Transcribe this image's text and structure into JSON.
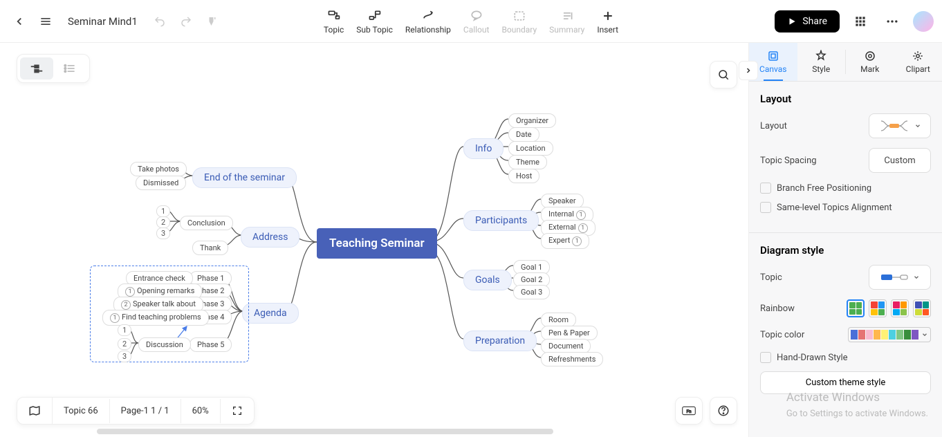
{
  "header": {
    "doc_title": "Seminar Mind1",
    "tb_items": [
      {
        "label": "Topic",
        "disabled": false
      },
      {
        "label": "Sub Topic",
        "disabled": false
      },
      {
        "label": "Relationship",
        "disabled": false
      },
      {
        "label": "Callout",
        "disabled": true
      },
      {
        "label": "Boundary",
        "disabled": true
      },
      {
        "label": "Summary",
        "disabled": true
      },
      {
        "label": "Insert",
        "disabled": false
      }
    ],
    "share": "Share"
  },
  "sidebar": {
    "tabs": [
      "Canvas",
      "Style",
      "Mark",
      "Clipart"
    ],
    "layout": {
      "title": "Layout",
      "layout_lbl": "Layout",
      "spacing_lbl": "Topic Spacing",
      "spacing_val": "Custom",
      "chk1": "Branch Free Positioning",
      "chk2": "Same-level Topics Alignment"
    },
    "diagram": {
      "title": "Diagram style",
      "topic_lbl": "Topic",
      "rainbow_lbl": "Rainbow",
      "color_lbl": "Topic color",
      "hand_lbl": "Hand-Drawn Style",
      "custom_btn": "Custom theme style"
    }
  },
  "bottom": {
    "topic": "Topic 66",
    "page": "Page-1  1 / 1",
    "zoom": "60%"
  },
  "watermark": {
    "l1": "Activate Windows",
    "l2": "Go to Settings to activate Windows."
  },
  "mindmap": {
    "root": "Teaching Seminar",
    "right": [
      {
        "name": "Info",
        "children": [
          "Organizer",
          "Date",
          "Location",
          "Theme",
          "Host"
        ]
      },
      {
        "name": "Participants",
        "children": [
          "Speaker",
          "Internal",
          "External",
          "Expert"
        ],
        "badges": [
          null,
          "1",
          "1",
          "1"
        ]
      },
      {
        "name": "Goals",
        "children": [
          "Goal 1",
          "Goal 2",
          "Goal 3"
        ]
      },
      {
        "name": "Preparation",
        "children": [
          "Room",
          "Pen & Paper",
          "Document",
          "Refreshments"
        ]
      }
    ],
    "left": [
      {
        "name": "End of the seminar",
        "children": [
          "Take photos",
          "Dismissed"
        ]
      },
      {
        "name": "Address",
        "children": [
          "Conclusion",
          "Thank"
        ],
        "sub": {
          "Conclusion": [
            "1",
            "2",
            "3"
          ]
        }
      },
      {
        "name": "Agenda",
        "children": [
          "Phase 1",
          "Phase 2",
          "Phase 3",
          "Phase 4",
          "Phase 5"
        ],
        "sub": {
          "Phase 1": [
            "Entrance check"
          ],
          "Phase 2": [
            "Opening remarks"
          ],
          "Phase 3": [
            "Speaker talk about"
          ],
          "Phase 4": [
            "Find teaching problems"
          ],
          "Phase 5": [
            "Discussion"
          ]
        },
        "discussion_sub": [
          "1",
          "2",
          "3"
        ]
      }
    ]
  }
}
